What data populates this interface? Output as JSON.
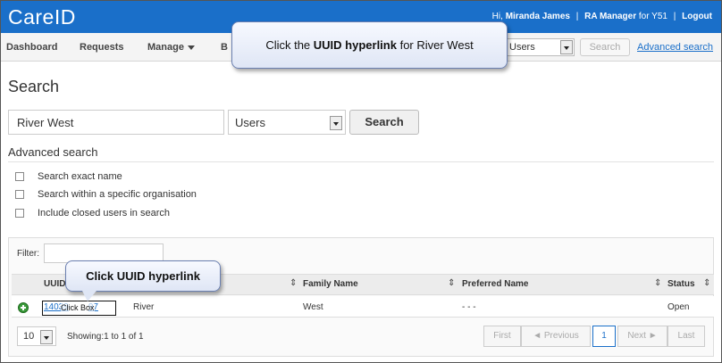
{
  "header": {
    "brand": "CareID",
    "greeting": "Hi,",
    "user_name": "Miranda James",
    "role_prefix": "RA Manager",
    "role_suffix": "for Y51",
    "logout": "Logout"
  },
  "nav": {
    "items": [
      {
        "label": "Dashboard"
      },
      {
        "label": "Requests"
      },
      {
        "label": "Manage"
      },
      {
        "label": "B"
      }
    ],
    "search_type": "Users",
    "search_button": "Search",
    "advanced_link": "Advanced search"
  },
  "page": {
    "title": "Search"
  },
  "search": {
    "query": "River West",
    "type": "Users",
    "button": "Search"
  },
  "advanced": {
    "title": "Advanced search",
    "options": [
      {
        "label": "Search exact name",
        "checked": false
      },
      {
        "label": "Search within a specific organisation",
        "checked": false
      },
      {
        "label": "Include closed users in search",
        "checked": false
      }
    ]
  },
  "results": {
    "filter_label": "Filter:",
    "columns": [
      "UUID",
      "Family Name",
      "Preferred Name",
      "Status"
    ],
    "rows": [
      {
        "uuid": "14039",
        "uuid_end": "97",
        "given_name": "River",
        "family_name": "West",
        "preferred_name": "- - -",
        "status": "Open"
      }
    ],
    "page_size": "10",
    "showing": "Showing:1 to 1 of 1",
    "pager": {
      "first": "First",
      "previous": "Previous",
      "current": "1",
      "next": "Next",
      "last": "Last"
    }
  },
  "callouts": {
    "top": {
      "prefix": "Click the ",
      "emphasis": "UUID hyperlink",
      "suffix": " for River West"
    },
    "bottom": "Click UUID hyperlink",
    "click_box": "Click Box"
  },
  "colors": {
    "header_bg": "#1a6fc9",
    "link": "#1a6fc9",
    "status_open_icon": "#3a9a3a"
  }
}
